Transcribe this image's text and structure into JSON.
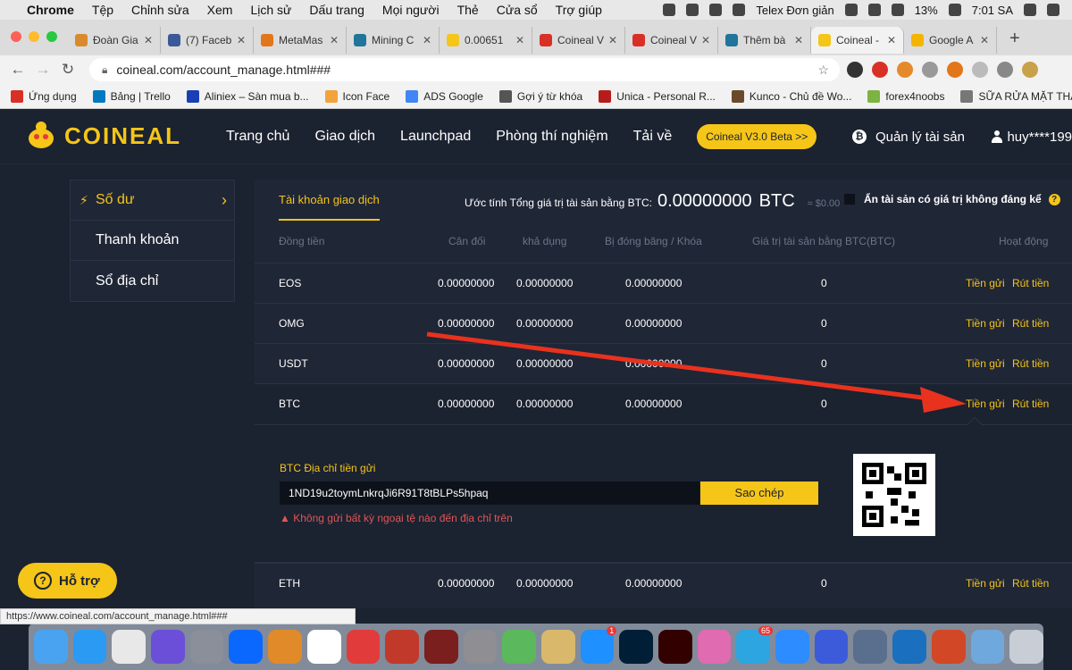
{
  "menubar": {
    "app": "Chrome",
    "items": [
      "Tệp",
      "Chỉnh sửa",
      "Xem",
      "Lịch sử",
      "Dấu trang",
      "Mọi người",
      "Thẻ",
      "Cửa sổ",
      "Trợ giúp"
    ],
    "input_method": "Telex Đơn giản",
    "battery": "13%",
    "clock": "7:01 SA"
  },
  "tabs": [
    {
      "title": "Đoàn Gia",
      "color": "#d98a2b"
    },
    {
      "title": "(7) Faceb",
      "color": "#3b5998"
    },
    {
      "title": "MetaMas",
      "color": "#e2761b"
    },
    {
      "title": "Mining C",
      "color": "#21759b"
    },
    {
      "title": "0.00651",
      "color": "#f5c518"
    },
    {
      "title": "Coineal V",
      "color": "#d93025"
    },
    {
      "title": "Coineal V",
      "color": "#d93025"
    },
    {
      "title": "Thêm bà",
      "color": "#21759b"
    },
    {
      "title": "Coineal -",
      "color": "#f5c518",
      "active": true
    },
    {
      "title": "Google A",
      "color": "#f5b400"
    }
  ],
  "url": "coineal.com/account_manage.html###",
  "bookmarks": [
    {
      "label": "Ứng dụng",
      "color": "#d93025"
    },
    {
      "label": "Bảng | Trello",
      "color": "#0079bf"
    },
    {
      "label": "Aliniex – Sàn mua b...",
      "color": "#1a3fb5"
    },
    {
      "label": "Icon Face",
      "color": "#f2a33a"
    },
    {
      "label": "ADS Google",
      "color": "#4285f4"
    },
    {
      "label": "Gợi ý từ khóa",
      "color": "#555555"
    },
    {
      "label": "Unica - Personal R...",
      "color": "#b71c1c"
    },
    {
      "label": "Kunco - Chủ đề Wo...",
      "color": "#6b4a2b"
    },
    {
      "label": "forex4noobs",
      "color": "#7cb342"
    },
    {
      "label": "SỮA RỬA MẶT THA...",
      "color": "#777777"
    }
  ],
  "site": {
    "logo": "COINEAL",
    "nav": [
      "Trang chủ",
      "Giao dịch",
      "Launchpad",
      "Phòng thí nghiệm",
      "Tải về"
    ],
    "beta": "Coineal V3.0 Beta >>",
    "asset_mgmt": "Quản lý tài sản",
    "user": "huy****199"
  },
  "sidebar": [
    "Số dư",
    "Thanh khoản",
    "Sổ địa chỉ"
  ],
  "panel": {
    "tab": "Tài khoản giao dịch",
    "estimate_label": "Ước tính Tổng giá trị tài sản bằng BTC:",
    "estimate_value": "0.00000000",
    "estimate_unit": "BTC",
    "estimate_usd": "≈ $0.00",
    "hide_small": "Ẩn tài sản có giá trị không đáng kể"
  },
  "columns": [
    "Đồng tiền",
    "Cân đối",
    "khả dụng",
    "Bị đóng băng / Khóa",
    "Giá trị tài sản bằng BTC(BTC)",
    "Hoạt động"
  ],
  "actions": {
    "deposit": "Tiền gửi",
    "withdraw": "Rút tiền"
  },
  "rows": [
    {
      "coin": "EOS",
      "balance": "0.00000000",
      "available": "0.00000000",
      "frozen": "0.00000000",
      "btc": "0"
    },
    {
      "coin": "OMG",
      "balance": "0.00000000",
      "available": "0.00000000",
      "frozen": "0.00000000",
      "btc": "0"
    },
    {
      "coin": "USDT",
      "balance": "0.00000000",
      "available": "0.00000000",
      "frozen": "0.00000000",
      "btc": "0"
    },
    {
      "coin": "BTC",
      "balance": "0.00000000",
      "available": "0.00000000",
      "frozen": "0.00000000",
      "btc": "0"
    },
    {
      "coin": "ETH",
      "balance": "0.00000000",
      "available": "0.00000000",
      "frozen": "0.00000000",
      "btc": "0"
    }
  ],
  "deposit": {
    "label": "BTC Địa chỉ tiền gửi",
    "address": "1ND19u2toymLnkrqJi6R91T8tBLPs5hpaq",
    "copy": "Sao chép",
    "warning": "Không gửi bất kỳ ngoại tệ nào đến địa chỉ trên"
  },
  "help": "Hỗ trợ",
  "status_url": "https://www.coineal.com/account_manage.html###",
  "dock": [
    {
      "name": "finder",
      "color": "#4aa3f0"
    },
    {
      "name": "safari",
      "color": "#2b9af3"
    },
    {
      "name": "chrome",
      "color": "#e8e8e8"
    },
    {
      "name": "siri",
      "color": "#6b4fd8"
    },
    {
      "name": "launchpad",
      "color": "#8a8f99"
    },
    {
      "name": "zalo",
      "color": "#0a68ff"
    },
    {
      "name": "calculator",
      "color": "#e08a2a"
    },
    {
      "name": "calendar",
      "color": "#ffffff"
    },
    {
      "name": "app-red",
      "color": "#e23b3b"
    },
    {
      "name": "app-stripes",
      "color": "#c0392b"
    },
    {
      "name": "photo-booth",
      "color": "#7a1e1e"
    },
    {
      "name": "system-preferences",
      "color": "#8e8e93"
    },
    {
      "name": "maps",
      "color": "#5cb85c"
    },
    {
      "name": "preview",
      "color": "#d9b86b"
    },
    {
      "name": "app-store",
      "color": "#1e90ff",
      "badge": "1"
    },
    {
      "name": "photoshop",
      "color": "#001e36"
    },
    {
      "name": "illustrator",
      "color": "#330000"
    },
    {
      "name": "folder-pink",
      "color": "#e06bb0"
    },
    {
      "name": "telegram",
      "color": "#2ca5e0",
      "badge": "65"
    },
    {
      "name": "zoom",
      "color": "#2d8cff"
    },
    {
      "name": "atom",
      "color": "#3b5bdb"
    },
    {
      "name": "photos",
      "color": "#5a6f8e"
    },
    {
      "name": "quicktime",
      "color": "#1b6fbf"
    },
    {
      "name": "powerpoint",
      "color": "#d24726"
    },
    {
      "name": "folder",
      "color": "#6fa8dc"
    },
    {
      "name": "trash",
      "color": "#c9ced6"
    }
  ]
}
